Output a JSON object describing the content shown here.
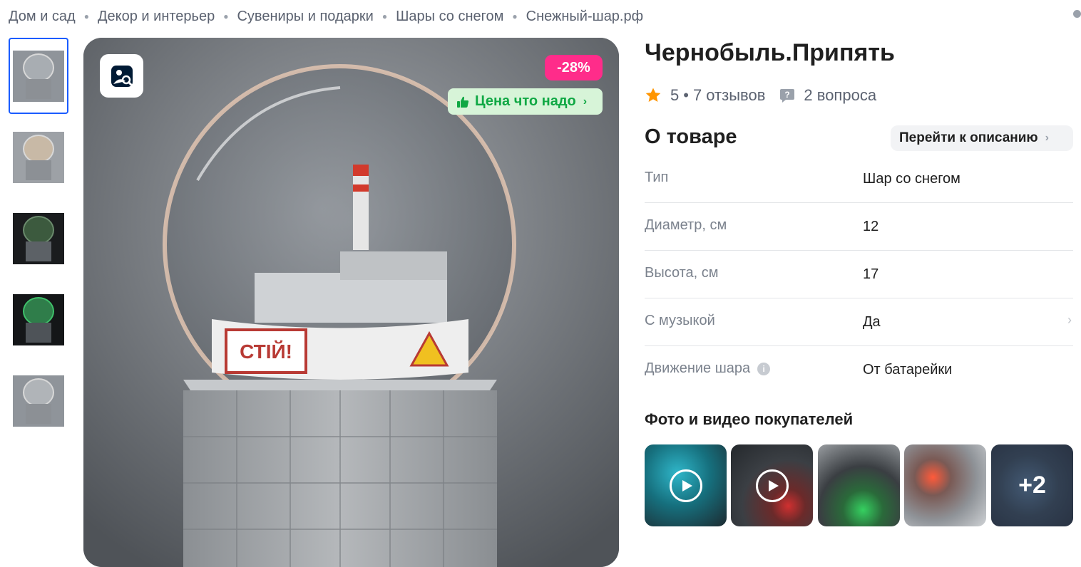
{
  "breadcrumb": [
    "Дом и сад",
    "Декор и интерьер",
    "Сувениры и подарки",
    "Шары со снегом",
    "Снежный-шар.рф"
  ],
  "gallery": {
    "thumbnails": [
      "thumb-1",
      "thumb-2",
      "thumb-3",
      "thumb-4",
      "thumb-5"
    ],
    "discount": "-28%",
    "price_badge": "Цена что надо"
  },
  "product": {
    "title": "Чернобыль.Припять",
    "rating": "5",
    "reviews": "7 отзывов",
    "questions": "2 вопроса"
  },
  "about": {
    "heading": "О товаре",
    "goto_description": "Перейти к описанию",
    "specs": [
      {
        "name": "Тип",
        "value": "Шар со снегом"
      },
      {
        "name": "Диаметр, см",
        "value": "12"
      },
      {
        "name": "Высота, см",
        "value": "17"
      },
      {
        "name": "С музыкой",
        "value": "Да"
      },
      {
        "name": "Движение шара",
        "value": "От батарейки"
      }
    ]
  },
  "buyer_media": {
    "heading": "Фото и видео покупателей",
    "more": "+2"
  },
  "colors": {
    "accent": "#1a5cff",
    "discount": "#ff2c8a",
    "price_badge_bg": "#d7f4d8",
    "price_badge_text": "#10a844",
    "star": "#ff9500"
  },
  "icons": {
    "search": "image-search-icon",
    "star": "star-icon",
    "question": "question-bubble-icon",
    "play": "play-icon",
    "thumbs_up": "thumbs-up-icon"
  }
}
